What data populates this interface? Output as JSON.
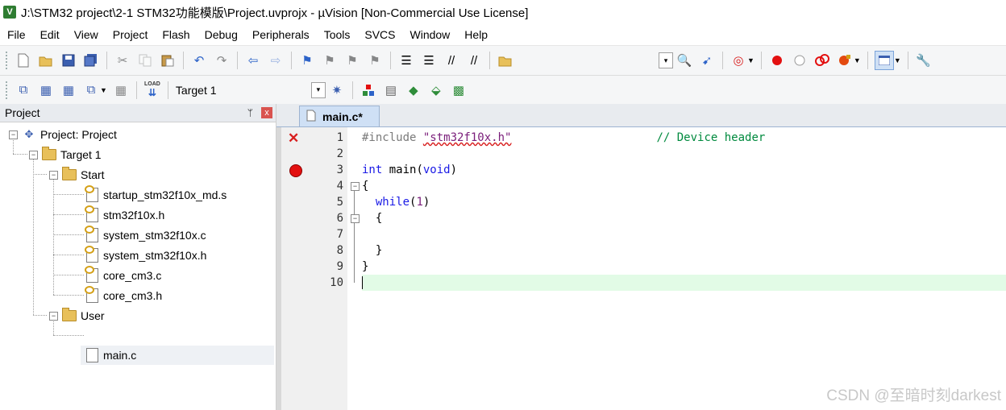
{
  "window": {
    "title": "J:\\STM32 project\\2-1 STM32功能模版\\Project.uvprojx - µVision  [Non-Commercial Use License]",
    "app_icon_letter": "V"
  },
  "menu": [
    "File",
    "Edit",
    "View",
    "Project",
    "Flash",
    "Debug",
    "Peripherals",
    "Tools",
    "SVCS",
    "Window",
    "Help"
  ],
  "toolbar1": {
    "icons": [
      "new-file-icon",
      "open-icon",
      "save-icon",
      "save-all-icon",
      "cut-icon",
      "copy-icon",
      "paste-icon",
      "undo-icon",
      "redo-icon",
      "nav-back-icon",
      "nav-forward-icon",
      "bookmark-icon",
      "bookmark-prev-icon",
      "bookmark-next-icon",
      "bookmark-clear-icon",
      "indent-icon",
      "unindent-icon",
      "comment-icon",
      "uncomment-icon",
      "find-in-files-icon",
      "find-combo-icon",
      "find-icon",
      "incremental-find-icon",
      "debug-session-icon",
      "breakpoint-icon",
      "breakpoint-disable-icon",
      "breakpoint-kill-icon",
      "breakpoint-all-icon",
      "window-layout-icon",
      "configure-icon"
    ]
  },
  "toolbar2": {
    "target": "Target 1",
    "load_label": "LOAD"
  },
  "project_panel": {
    "title": "Project",
    "pin_glyph": "ᛘ",
    "close_glyph": "x",
    "tree": {
      "project": "Project: Project",
      "target": "Target 1",
      "groups": [
        {
          "name": "Start",
          "files": [
            "startup_stm32f10x_md.s",
            "stm32f10x.h",
            "system_stm32f10x.c",
            "system_stm32f10x.h",
            "core_cm3.c",
            "core_cm3.h"
          ]
        },
        {
          "name": "User",
          "files": [
            "main.c"
          ]
        }
      ]
    }
  },
  "editor": {
    "tab": "main.c*",
    "line_numbers": [
      "1",
      "2",
      "3",
      "4",
      "5",
      "6",
      "7",
      "8",
      "9",
      "10"
    ],
    "lines": {
      "l1_pre": "#include ",
      "l1_str": "\"stm32f10x.h\"",
      "l1_comment": "// Device header",
      "l3_kw1": "int",
      "l3_mid": " main(",
      "l3_kw2": "void",
      "l3_end": ")",
      "l4": "{",
      "l5_kw": "while",
      "l5_open": "(",
      "l5_num": "1",
      "l5_close": ")",
      "l6": "{",
      "l8": "}",
      "l9": "}"
    }
  },
  "watermark": "CSDN @至暗时刻darkest"
}
